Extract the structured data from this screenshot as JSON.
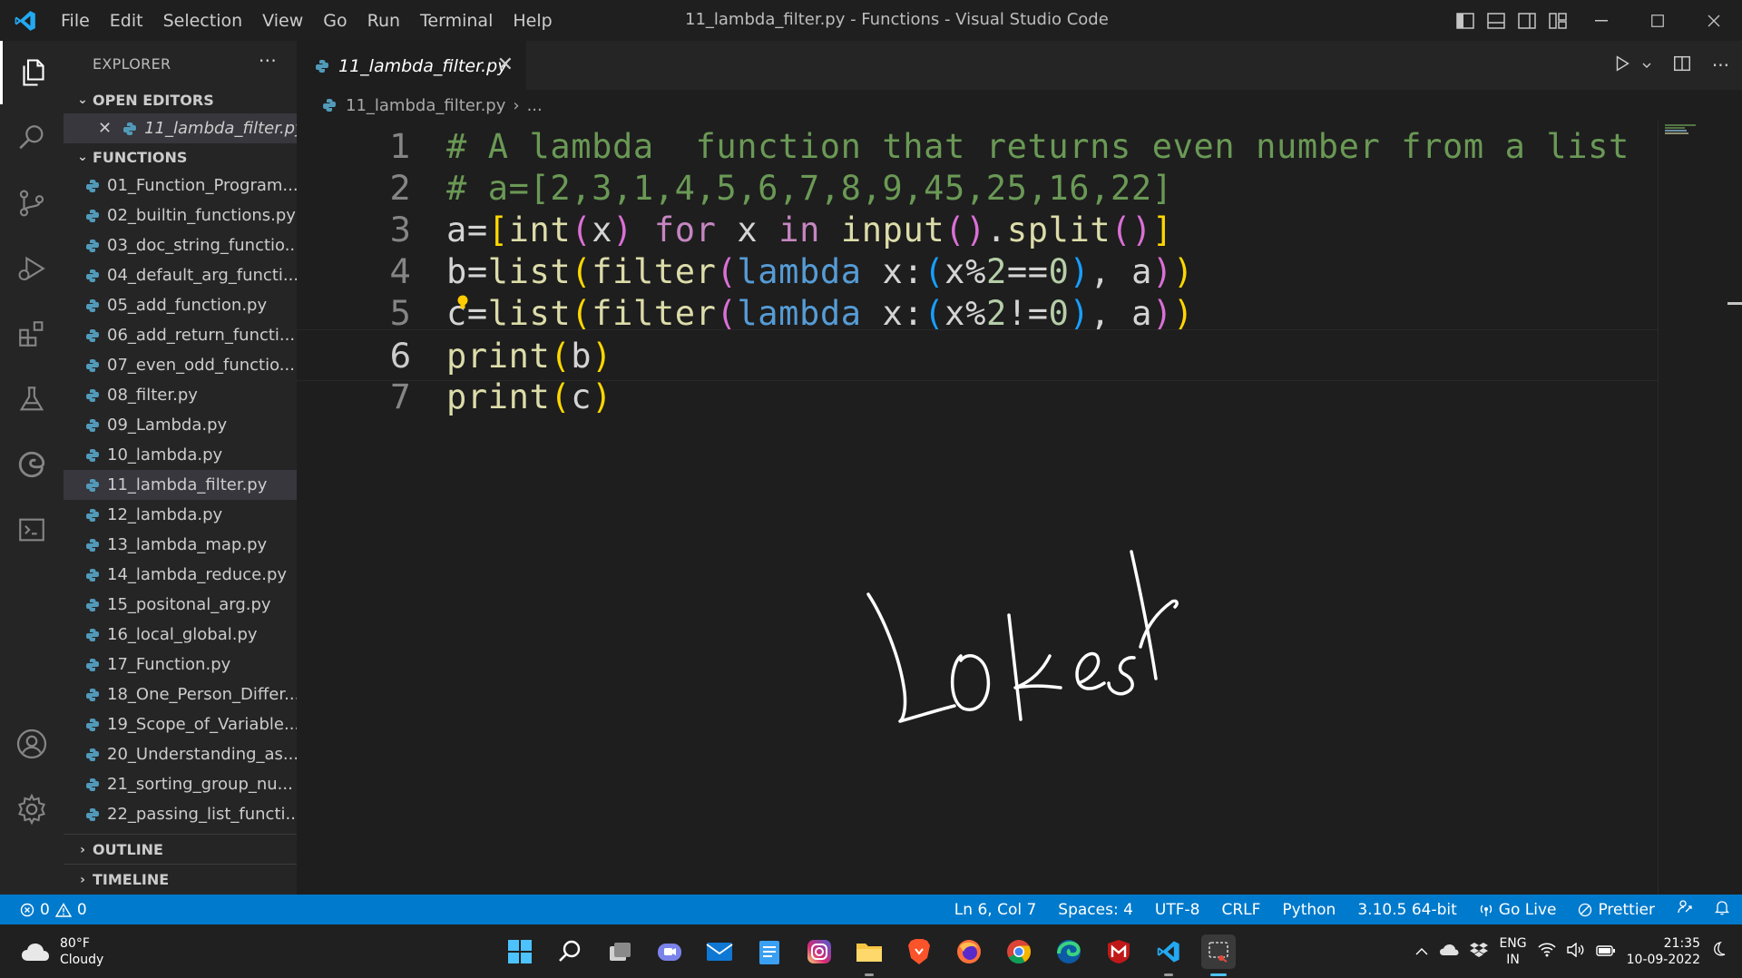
{
  "titlebar": {
    "menu": [
      "File",
      "Edit",
      "Selection",
      "View",
      "Go",
      "Run",
      "Terminal",
      "Help"
    ],
    "title": "11_lambda_filter.py - Functions - Visual Studio Code"
  },
  "sidebar": {
    "header": "EXPLORER",
    "more": "···",
    "open_editors_label": "OPEN EDITORS",
    "open_editor_file": "11_lambda_filter.py",
    "folder_label": "FUNCTIONS",
    "files": [
      "01_Function_Program...",
      "02_builtin_functions.py",
      "03_doc_string_functio...",
      "04_default_arg_functi...",
      "05_add_function.py",
      "06_add_return_functi...",
      "07_even_odd_functio...",
      "08_filter.py",
      "09_Lambda.py",
      "10_lambda.py",
      "11_lambda_filter.py",
      "12_lambda.py",
      "13_lambda_map.py",
      "14_lambda_reduce.py",
      "15_positonal_arg.py",
      "16_local_global.py",
      "17_Function.py",
      "18_One_Person_Differ...",
      "19_Scope_of_Variable...",
      "20_Understanding_as...",
      "21_sorting_group_nu...",
      "22_passing_list_functi..."
    ],
    "outline_label": "OUTLINE",
    "timeline_label": "TIMELINE"
  },
  "editor": {
    "tab_label": "11_lambda_filter.py",
    "breadcrumb_file": "11_lambda_filter.py",
    "breadcrumb_rest": "...",
    "line_numbers": [
      "1",
      "2",
      "3",
      "4",
      "5",
      "6",
      "7"
    ]
  },
  "statusbar": {
    "errors": "0",
    "warnings": "0",
    "position": "Ln 6, Col 7",
    "spaces": "Spaces: 4",
    "encoding": "UTF-8",
    "eol": "CRLF",
    "language": "Python",
    "interpreter": "3.10.5 64-bit",
    "go_live": "Go Live",
    "prettier": "Prettier"
  },
  "taskbar": {
    "temperature": "80°F",
    "condition": "Cloudy",
    "lang_top": "ENG",
    "lang_bottom": "IN",
    "time": "21:35",
    "date": "10-09-2022"
  },
  "colors": {
    "accent": "#007acc",
    "comment": "#6a9955",
    "keyword": "#569cd6",
    "function": "#dcdcaa",
    "number": "#b5cea8",
    "bracket1": "#ffd700",
    "bracket2": "#da70d6",
    "bracket3": "#179fff"
  }
}
